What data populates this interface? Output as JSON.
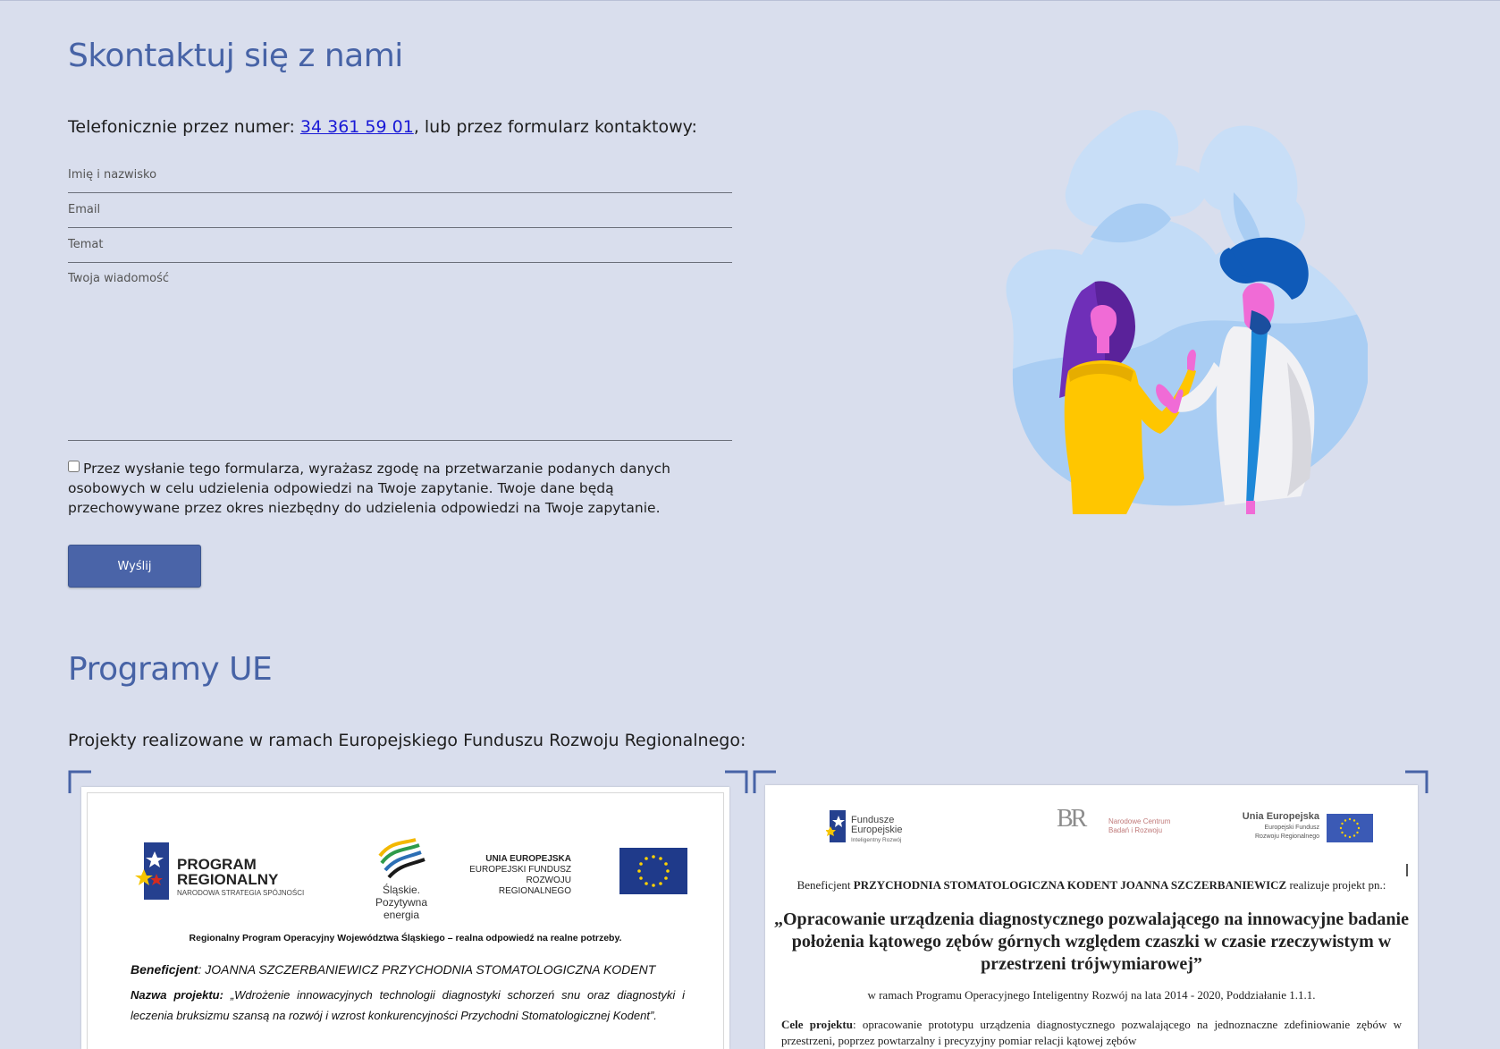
{
  "contact": {
    "heading": "Skontaktuj się z nami",
    "phone_prefix": "Telefonicznie przez numer: ",
    "phone_number": "34 361 59 01",
    "phone_suffix": ", lub przez formularz kontaktowy:",
    "fields": {
      "name_placeholder": "Imię i nazwisko",
      "email_placeholder": "Email",
      "subject_placeholder": "Temat",
      "message_placeholder": "Twoja wiadomość"
    },
    "consent_text": "Przez wysłanie tego formularza, wyrażasz zgodę na przetwarzanie podanych danych osobowych w celu udzielenia odpowiedzi na Twoje zapytanie. Twoje dane będą przechowywane przez okres niezbędny do udzielenia odpowiedzi na Twoje zapytanie.",
    "consent_checked": false,
    "submit_label": "Wyślij"
  },
  "eu": {
    "heading": "Programy UE",
    "intro": "Projekty realizowane w ramach Europejskiego Funduszu Rozwoju Regionalnego:",
    "doc1": {
      "logo_pr_title1": "PROGRAM",
      "logo_pr_title2": "REGIONALNY",
      "logo_pr_sub": "NARODOWA STRATEGIA SPÓJNOŚCI",
      "logo_sl_name": "Śląskie.",
      "logo_sl_tag": "Pozytywna energia",
      "logo_eu_l1": "UNIA EUROPEJSKA",
      "logo_eu_l2": "EUROPEJSKI FUNDUSZ",
      "logo_eu_l3": "ROZWOJU REGIONALNEGO",
      "program_line": "Regionalny Program Operacyjny Województwa Śląskiego – realna odpowiedź na realne potrzeby.",
      "beneficiary_label": "Beneficjent",
      "beneficiary_value": ": JOANNA SZCZERBANIEWICZ PRZYCHODNIA STOMATOLOGICZNA KODENT",
      "project_label": "Nazwa projektu:",
      "project_value": " „Wdrożenie innowacyjnych technologii diagnostyki schorzeń snu oraz diagnostyki i leczenia bruksizmu  szansą na rozwój i wzrost konkurencyjności Przychodni Stomatologicznej Kodent”."
    },
    "doc2": {
      "logo_fe_l1": "Fundusze",
      "logo_fe_l2": "Europejskie",
      "logo_fe_l3": "Inteligentny Rozwój",
      "logo_ncbr_l1": "Narodowe Centrum",
      "logo_ncbr_l2": "Badań i Rozwoju",
      "logo_eu_l1": "Unia Europejska",
      "logo_eu_l2": "Europejski Fundusz",
      "logo_eu_l3": "Rozwoju Regionalnego",
      "beneficiary_prefix": "Beneficjent ",
      "beneficiary_name": "PRZYCHODNIA STOMATOLOGICZNA KODENT JOANNA SZCZERBANIEWICZ",
      "beneficiary_suffix": " realizuje projekt pn.:",
      "project_title": "„Opracowanie urządzenia diagnostycznego pozwalającego na innowacyjne badanie położenia kątowego zębów górnych względem czaszki w czasie rzeczywistym w przestrzeni trójwymiarowej”",
      "program_line": "w ramach Programu Operacyjnego Inteligentny Rozwój na lata 2014 - 2020, Poddziałanie 1.1.1.",
      "goals_label": "Cele projektu",
      "goals_text": ": opracowanie prototypu urządzenia diagnostycznego pozwalającego na jednoznaczne zdefiniowanie zębów w przestrzeni, poprzez powtarzalny i precyzyjny pomiar relacji kątowej zębów"
    }
  },
  "colors": {
    "background": "#d9deed",
    "heading": "#4763a6",
    "button": "#4a64a8",
    "link": "#1a1ad6"
  }
}
